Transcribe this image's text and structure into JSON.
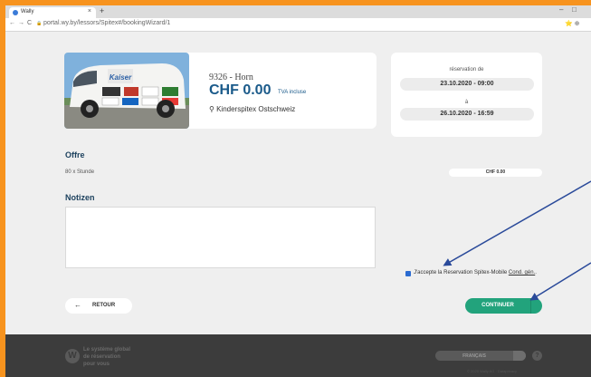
{
  "browser": {
    "tab_title": "Wally",
    "tab_close": "×",
    "new_tab": "+",
    "url": "portal.wy.by/lessors/Spitex#/bookingWizard/1",
    "nav_back": "←",
    "nav_forward": "→",
    "reload": "C",
    "lock": "🔒",
    "win_min": "–",
    "win_max": "□",
    "win_close": "×",
    "menu_icons": "⭐ ⊕"
  },
  "vehicle": {
    "location_code": "9326 - Horn",
    "price": "CHF 0.00",
    "price_note": "TVA incluse",
    "provider": "Kinderspitex Ostschweiz",
    "image_brand": "Kaiser"
  },
  "reservation": {
    "from_label": "réservation de",
    "from_value": "23.10.2020 - 09:00",
    "to_label": "à",
    "to_value": "26.10.2020 - 16:59"
  },
  "offer": {
    "title": "Offre",
    "row_label": "80 x Stunde",
    "row_value": "CHF 0.00"
  },
  "notes": {
    "title": "Notizen",
    "value": ""
  },
  "terms": {
    "text": "J'accepte la Reservation Spitex-Mobile",
    "link": "Cond. gén.",
    "end": "."
  },
  "buttons": {
    "back_arrow": "←",
    "back": "RETOUR",
    "continue": "CONTINUER"
  },
  "footer": {
    "logo": "W",
    "tagline_line1": "Le système global",
    "tagline_line2": "de réservation",
    "tagline_line3": "pour vous",
    "language": "FRANÇAIS",
    "help": "?",
    "copyright": "© 2020 Wally AG · Dataprivacy"
  },
  "colors": {
    "accent": "#22a37c",
    "heading": "#1a3f5c",
    "background": "#f7931e",
    "footer": "#3c3c3c"
  }
}
